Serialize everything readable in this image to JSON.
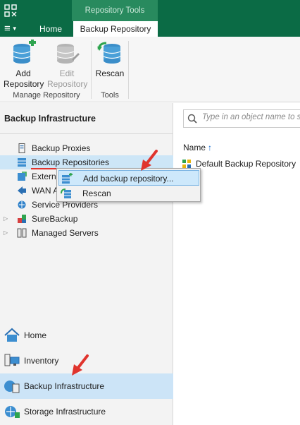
{
  "topbar": {
    "context_group": "Repository Tools",
    "menu_label": "≡",
    "tabs": [
      {
        "label": "Home"
      },
      {
        "label": "Backup Repository"
      }
    ]
  },
  "ribbon": {
    "buttons": [
      {
        "label_line1": "Add",
        "label_line2": "Repository",
        "icon": "add-repository-icon",
        "enabled": true
      },
      {
        "label_line1": "Edit",
        "label_line2": "Repository",
        "icon": "edit-repository-icon",
        "enabled": false
      },
      {
        "label_line1": "Rescan",
        "label_line2": "",
        "icon": "rescan-icon",
        "enabled": true
      }
    ],
    "groups": [
      {
        "label": "Manage Repository"
      },
      {
        "label": "Tools"
      }
    ]
  },
  "left_panel": {
    "title": "Backup Infrastructure",
    "tree": [
      {
        "label": "Backup Proxies",
        "icon": "server-icon"
      },
      {
        "label": "Backup Repositories",
        "icon": "repository-icon",
        "selected": true
      },
      {
        "label": "Externa",
        "icon": "external-repository-icon"
      },
      {
        "label": "WAN A",
        "icon": "wan-accelerator-icon"
      },
      {
        "label": "Service Providers",
        "icon": "service-provider-icon"
      },
      {
        "label": "SureBackup",
        "icon": "surebackup-icon",
        "expandable": true
      },
      {
        "label": "Managed Servers",
        "icon": "managed-servers-icon",
        "expandable": true
      }
    ],
    "nav": [
      {
        "label": "Home",
        "icon": "home-icon"
      },
      {
        "label": "Inventory",
        "icon": "inventory-icon"
      },
      {
        "label": "Backup Infrastructure",
        "icon": "backup-infrastructure-icon",
        "active": true
      },
      {
        "label": "Storage Infrastructure",
        "icon": "storage-infrastructure-icon"
      }
    ]
  },
  "main": {
    "search_placeholder": "Type in an object name to s",
    "column_header": "Name",
    "sort_indicator": "↑",
    "rows": [
      {
        "label": "Default Backup Repository",
        "icon": "repository-grid-icon"
      }
    ]
  },
  "context_menu": {
    "items": [
      {
        "label": "Add backup repository...",
        "icon": "add-repository-icon",
        "hover": true
      },
      {
        "label": "Rescan",
        "icon": "rescan-icon"
      }
    ]
  },
  "colors": {
    "brand_green": "#0b6b45",
    "context_green": "#288a5e",
    "selection": "#cde6f7",
    "annotation_red": "#e0342d"
  }
}
